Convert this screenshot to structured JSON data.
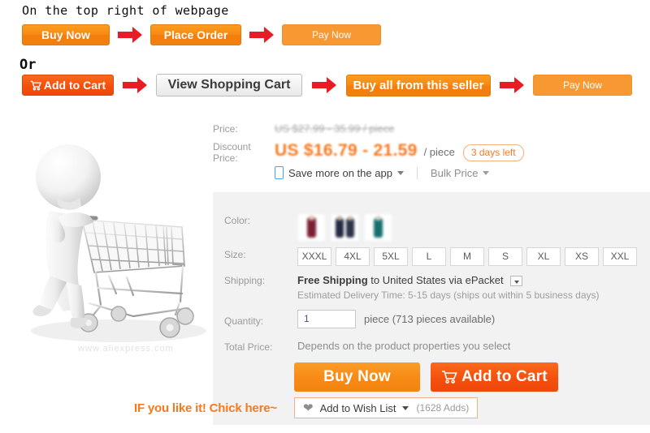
{
  "flow": {
    "heading_top": "On the top right of webpage",
    "heading_or": "Or",
    "row1": [
      {
        "label": "Buy Now",
        "style": "org-grad"
      },
      {
        "label": "Place Order",
        "style": "org-grad"
      },
      {
        "label": "Pay Now",
        "style": "org-flat"
      }
    ],
    "row2": [
      {
        "label": "Add to Cart",
        "style": "red-grad",
        "icon": "cart-icon"
      },
      {
        "label": "View Shopping Cart",
        "style": "white-grad"
      },
      {
        "label": "Buy all from this seller",
        "style": "org-grad"
      },
      {
        "label": "Pay Now",
        "style": "org-flat"
      }
    ],
    "arrow_color": "#e81c24"
  },
  "product": {
    "image_alt": "3d-white-figure-pushing-shopping-cart",
    "watermark": "www.aliexpress.com"
  },
  "price": {
    "label": "Price:",
    "original": "US $27.99 - 35.99 / piece",
    "discount_label": "Discount Price:",
    "discount_value": "US $16.79 - 21.59",
    "unit": "/ piece",
    "days_left_badge": "3 days left",
    "app_promo": "Save more on the app",
    "bulk_price": "Bulk Price",
    "accent": "#f7781f"
  },
  "options": {
    "color_label": "Color:",
    "colors": [
      {
        "name": "maroon",
        "hex": "#7b1f35"
      },
      {
        "name": "navy",
        "hex": "#232b42"
      },
      {
        "name": "teal",
        "hex": "#16706e"
      }
    ],
    "size_label": "Size:",
    "sizes": [
      "XXXL",
      "4XL",
      "5XL",
      "L",
      "M",
      "S",
      "XL",
      "XS",
      "XXL"
    ]
  },
  "shipping": {
    "label": "Shipping:",
    "free_text": "Free Shipping",
    "to_text": "to United States via ePacket",
    "estimate": "Estimated Delivery Time: 5-15 days (ships out within 5 business days)"
  },
  "quantity": {
    "label": "Quantity:",
    "value": "1",
    "placeholder": "1",
    "note": "piece (713 pieces available)"
  },
  "total": {
    "label": "Total Price:",
    "text": "Depends on the product properties you select"
  },
  "cta": {
    "buy_now": "Buy Now",
    "add_to_cart": "Add to Cart",
    "cart_icon": "cart-icon"
  },
  "wishlist": {
    "hint": "IF you like it! Chick here~",
    "heart_icon": "heart-icon",
    "label": "Add to Wish List",
    "count": "(1628 Adds)"
  }
}
